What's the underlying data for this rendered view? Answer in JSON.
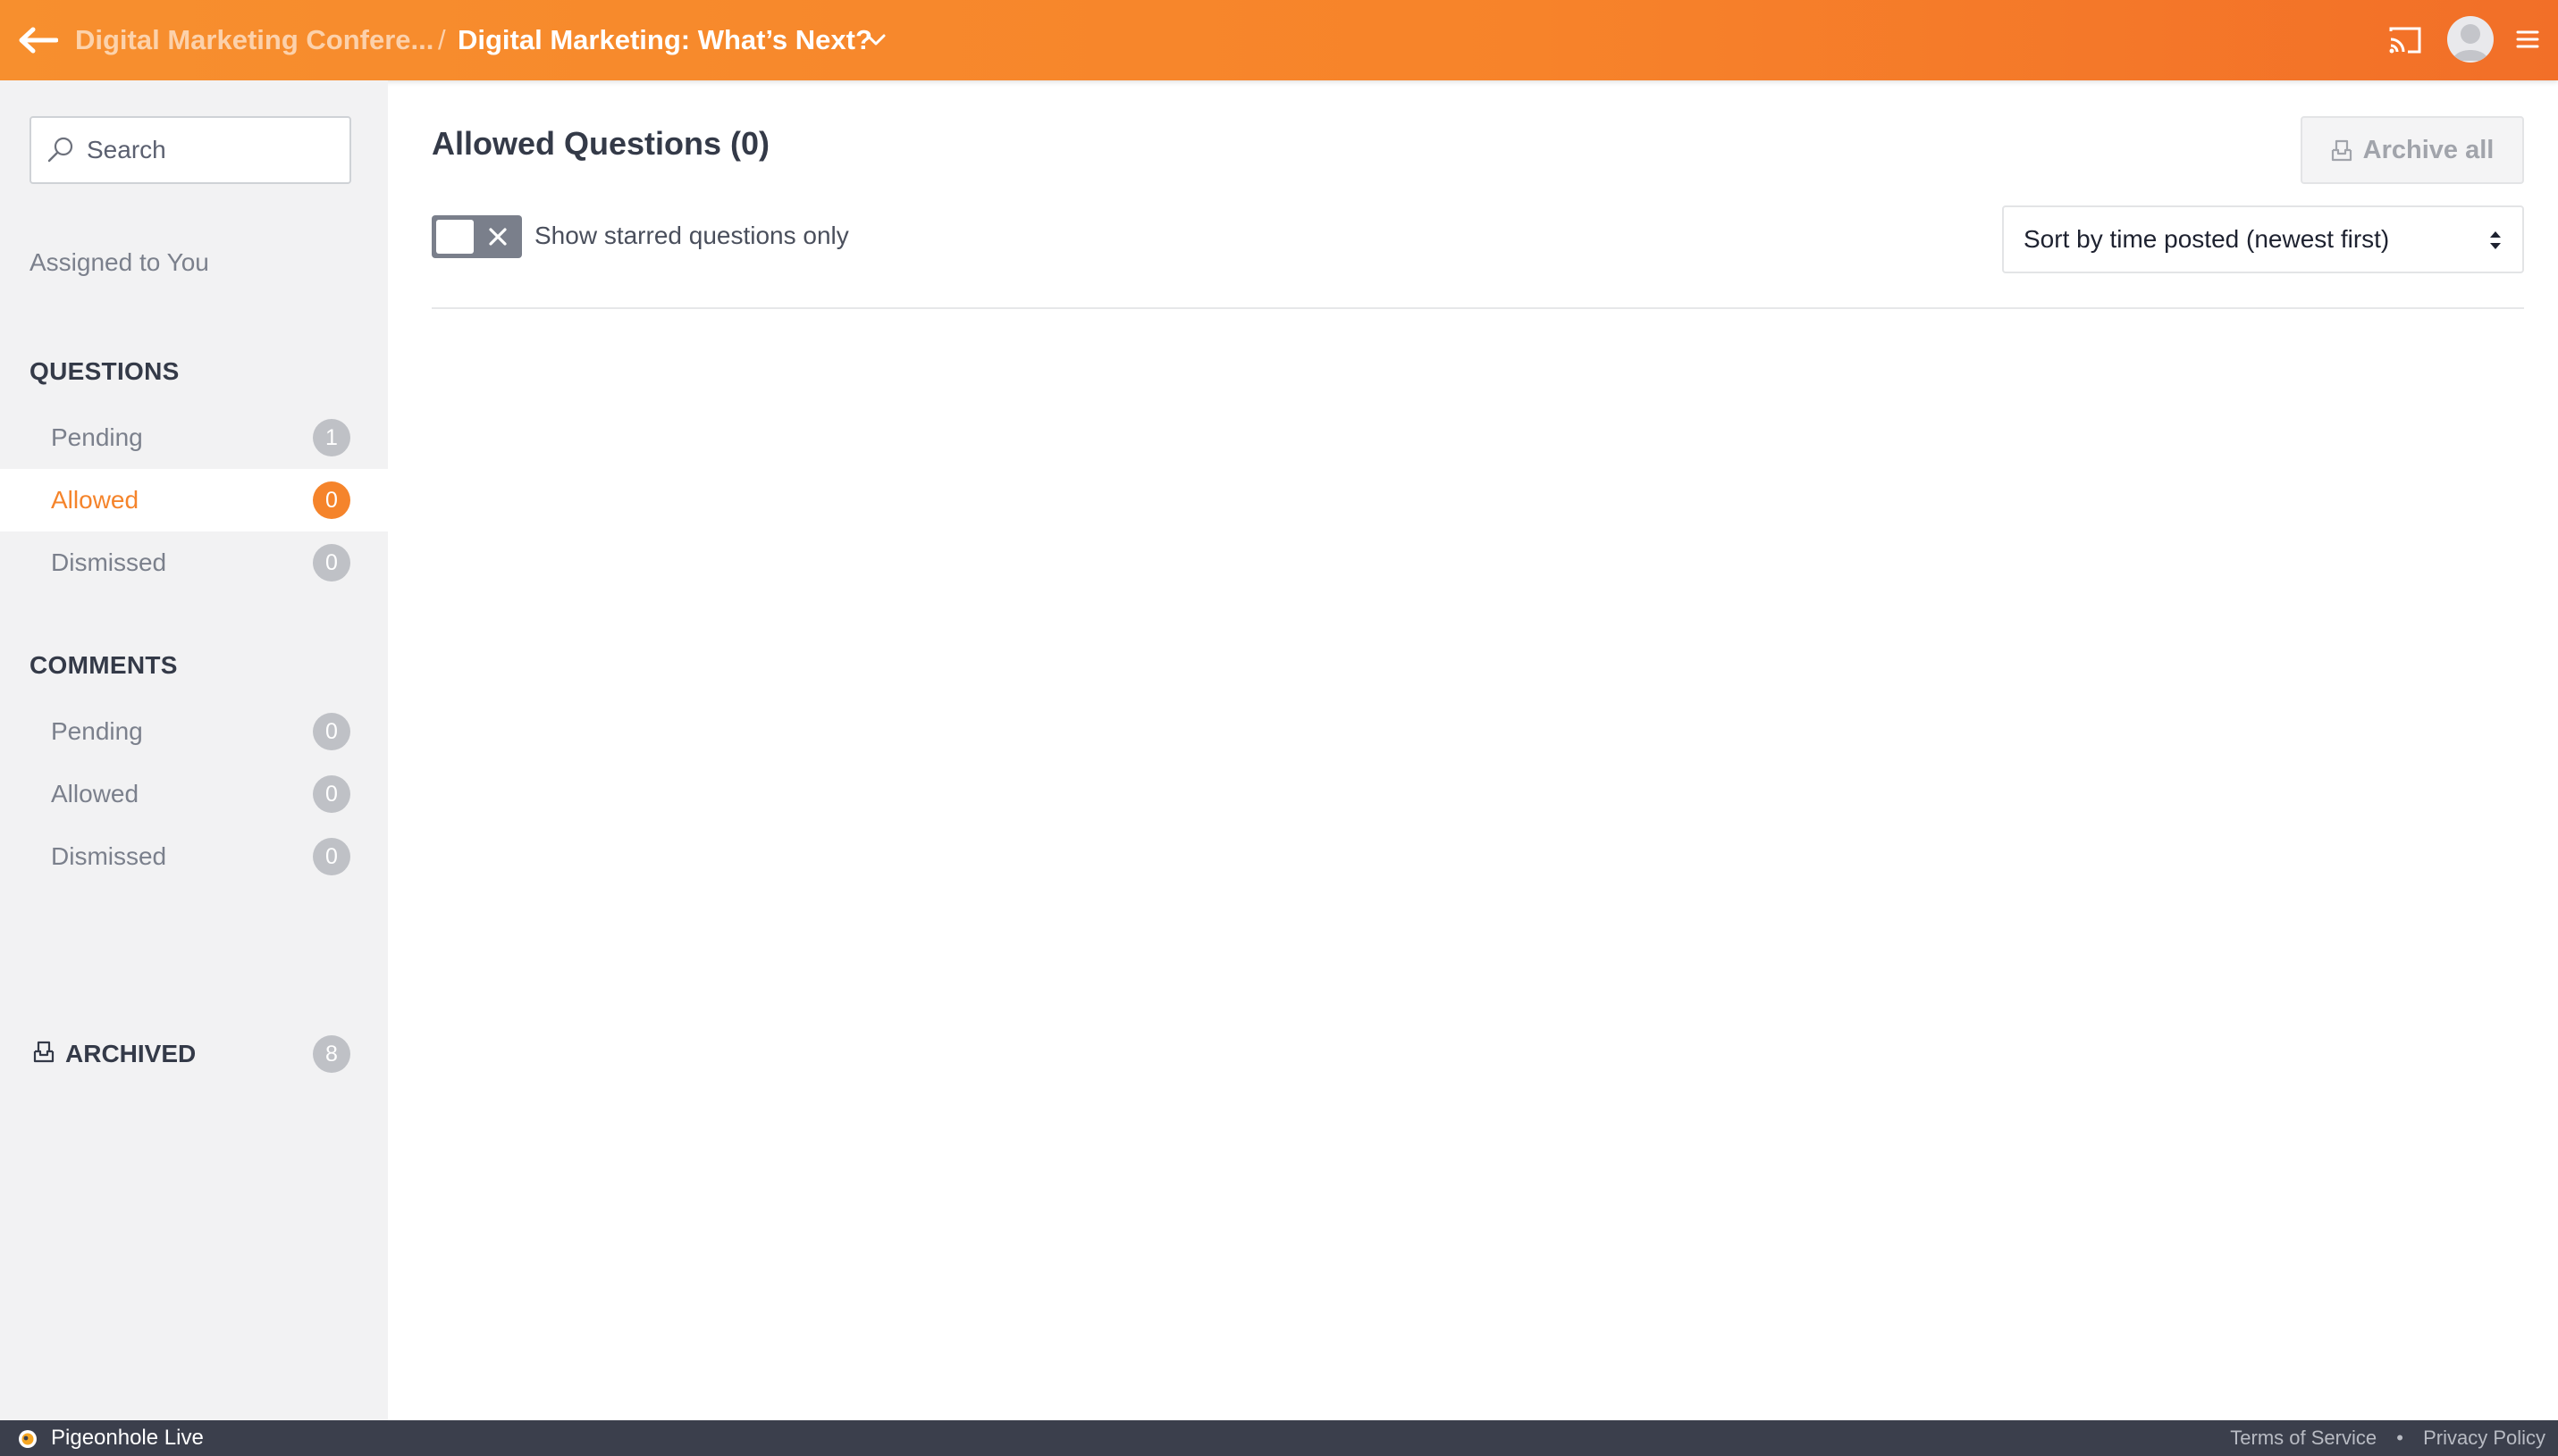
{
  "topbar": {
    "event_title": "Digital Marketing Confere...",
    "separator": "/",
    "session_title": "Digital Marketing: What’s Next?",
    "colors": {
      "gradient_start": "#f78f2e",
      "gradient_end": "#f26f28"
    }
  },
  "sidebar": {
    "search_placeholder": "Search",
    "assigned_label": "Assigned to You",
    "questions": {
      "heading": "QUESTIONS",
      "items": [
        {
          "label": "Pending",
          "count": "1"
        },
        {
          "label": "Allowed",
          "count": "0",
          "active": true
        },
        {
          "label": "Dismissed",
          "count": "0"
        }
      ]
    },
    "comments": {
      "heading": "COMMENTS",
      "items": [
        {
          "label": "Pending",
          "count": "0"
        },
        {
          "label": "Allowed",
          "count": "0"
        },
        {
          "label": "Dismissed",
          "count": "0"
        }
      ]
    },
    "archived": {
      "label": "ARCHIVED",
      "count": "8"
    }
  },
  "main": {
    "title": "Allowed Questions (0)",
    "archive_all_label": "Archive all",
    "starred_toggle_label": "Show starred questions only",
    "starred_toggle_on": false,
    "sort_value": "Sort by time posted (newest first)"
  },
  "footer": {
    "brand": "Pigeonhole Live",
    "terms": "Terms of Service",
    "bullet": "•",
    "privacy": "Privacy Policy"
  },
  "colors": {
    "accent": "#f5842b",
    "badge_gray": "#bfc1c6",
    "footer_bg": "#3b3f4c"
  }
}
